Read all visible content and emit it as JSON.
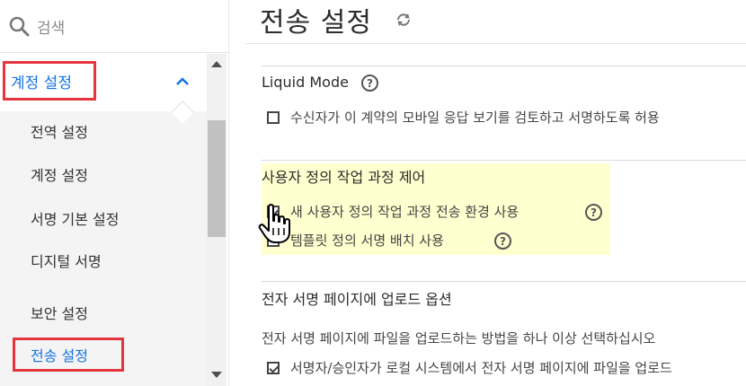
{
  "search": {
    "placeholder": "검색"
  },
  "sidebar": {
    "section_label": "계정 설정",
    "items": [
      {
        "label": "전역 설정"
      },
      {
        "label": "계정 설정"
      },
      {
        "label": "서명 기본 설정"
      },
      {
        "label": "디지털 서명"
      },
      {
        "label": "보안 설정"
      },
      {
        "label": "전송 설정"
      }
    ]
  },
  "page": {
    "title": "전송 설정"
  },
  "sections": {
    "liquid": {
      "title": "Liquid Mode",
      "option_label": "수신자가 이 계약의 모바일 응답 보기를 검토하고 서명하도록 허용",
      "option_checked": false
    },
    "workflow": {
      "title": "사용자 정의 작업 과정 제어",
      "options": [
        {
          "label": "새 사용자 정의 작업 과정 전송 환경 사용",
          "checked": true
        },
        {
          "label": "템플릿 정의 서명 배치 사용"
        }
      ]
    },
    "upload": {
      "title": "전자 서명 페이지에 업로드 옵션",
      "description": "전자 서명 페이지에 파일을 업로드하는 방법을 하나 이상 선택하십시오",
      "option_label": "서명자/승인자가 로컬 시스템에서 전자 서명 페이지에 파일을 업로드",
      "option_checked": true
    }
  },
  "help_glyph": "?",
  "colors": {
    "accent": "#1473e6",
    "annotation": "#e6353c",
    "highlight": "#ffffcf"
  }
}
